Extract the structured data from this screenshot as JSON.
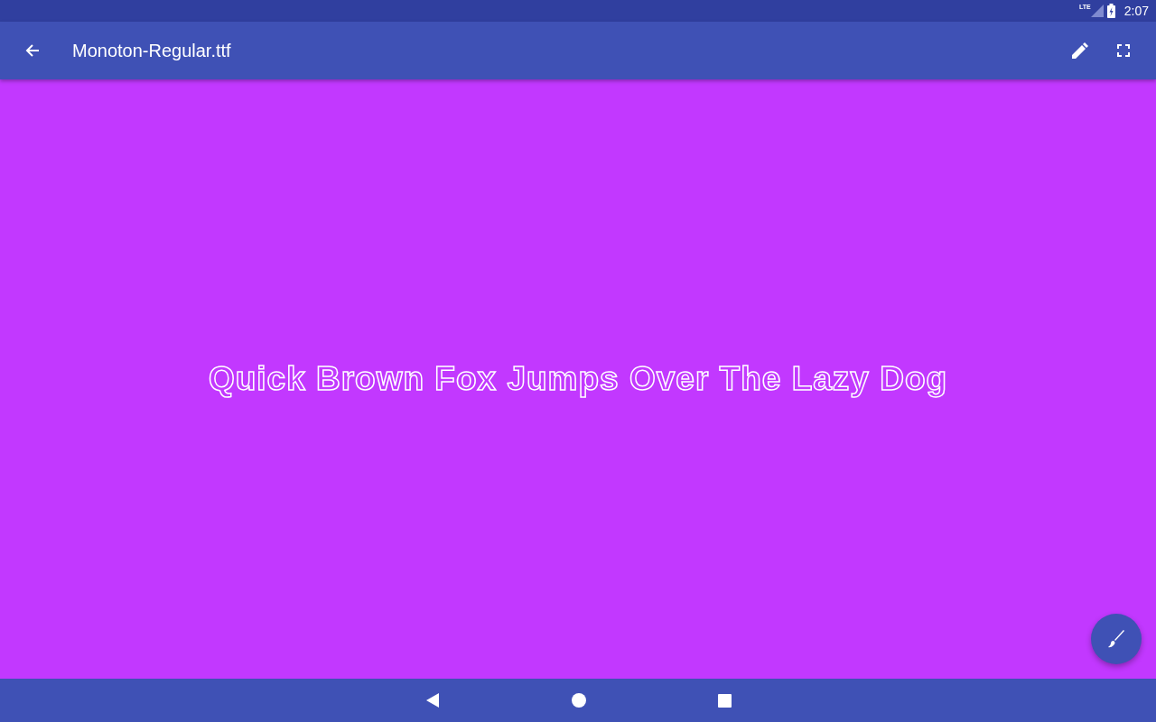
{
  "status_bar": {
    "network": "LTE",
    "time": "2:07"
  },
  "app_bar": {
    "title": "Monoton-Regular.ttf"
  },
  "preview": {
    "sample_text": "Quick Brown Fox Jumps Over The Lazy Dog"
  }
}
